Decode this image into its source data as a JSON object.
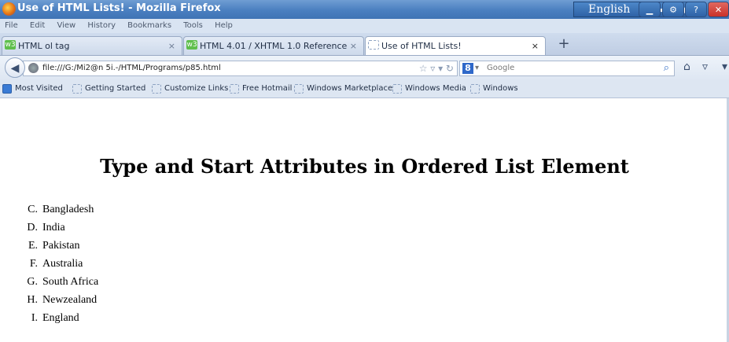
{
  "window": {
    "title": "Use of HTML Lists! - Mozilla Firefox",
    "lang_button": "English"
  },
  "menu": [
    "File",
    "Edit",
    "View",
    "History",
    "Bookmarks",
    "Tools",
    "Help"
  ],
  "tabs": [
    {
      "label": "HTML ol tag"
    },
    {
      "label": "HTML 4.01 / XHTML 1.0 Reference"
    },
    {
      "label": "Use of HTML Lists!",
      "active": true
    }
  ],
  "nav": {
    "url": "file:///G:/Mi2@n 5i.-/HTML/Programs/p85.html",
    "search_placeholder": "Google",
    "search_engine_icon": "8"
  },
  "bookmarks": [
    "Most Visited",
    "Getting Started",
    "Customize Links",
    "Free Hotmail",
    "Windows Marketplace",
    "Windows Media",
    "Windows"
  ],
  "page": {
    "heading": "Type and Start Attributes in Ordered List Element",
    "list": [
      {
        "marker": "C.",
        "text": "Bangladesh"
      },
      {
        "marker": "D.",
        "text": "India"
      },
      {
        "marker": "E.",
        "text": "Pakistan"
      },
      {
        "marker": "F.",
        "text": "Australia"
      },
      {
        "marker": "G.",
        "text": "South Africa"
      },
      {
        "marker": "H.",
        "text": "Newzealand"
      },
      {
        "marker": "I.",
        "text": "England"
      }
    ]
  },
  "colors": {
    "titlebar": "#4a7fc0",
    "close_button": "#c9312a"
  }
}
